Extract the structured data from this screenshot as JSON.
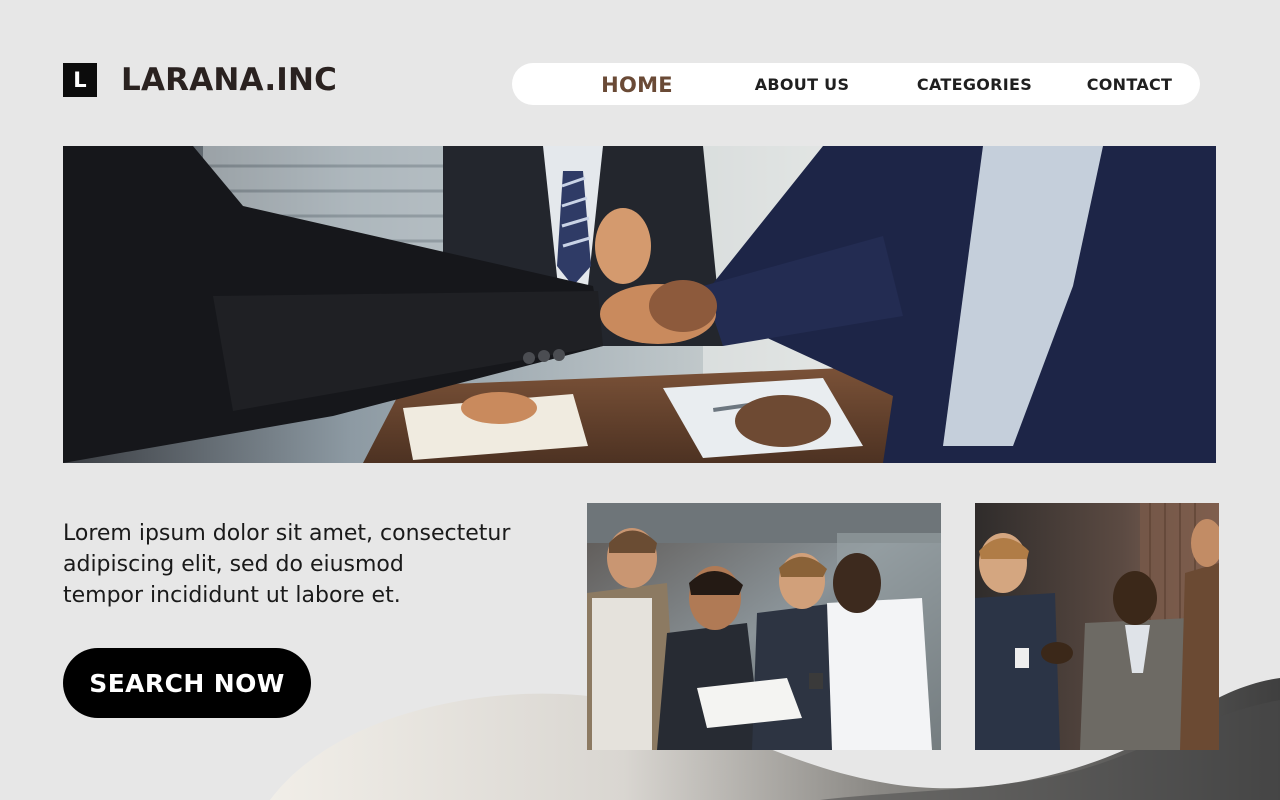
{
  "brand": {
    "logo_letter": "L",
    "name": "LARANA.INC"
  },
  "nav": {
    "items": [
      {
        "label": "HOME",
        "active": true
      },
      {
        "label": "ABOUT US",
        "active": false
      },
      {
        "label": "CATEGORIES",
        "active": false
      },
      {
        "label": "CONTACT",
        "active": false
      }
    ]
  },
  "hero": {
    "image": "business-handshake-photo"
  },
  "intro": {
    "lines": [
      "Lorem ipsum dolor sit amet, consectetur",
      "adipiscing elit, sed do eiusmod",
      "tempor incididunt ut labore et."
    ]
  },
  "cta": {
    "label": "SEARCH NOW"
  },
  "gallery": [
    {
      "image": "team-reviewing-documents-photo"
    },
    {
      "image": "colleagues-conversation-photo"
    }
  ],
  "colors": {
    "background": "#e7e7e7",
    "nav_active": "#6a4a36",
    "cta_background": "#000000",
    "wave_dark": "#4e4e4e"
  }
}
